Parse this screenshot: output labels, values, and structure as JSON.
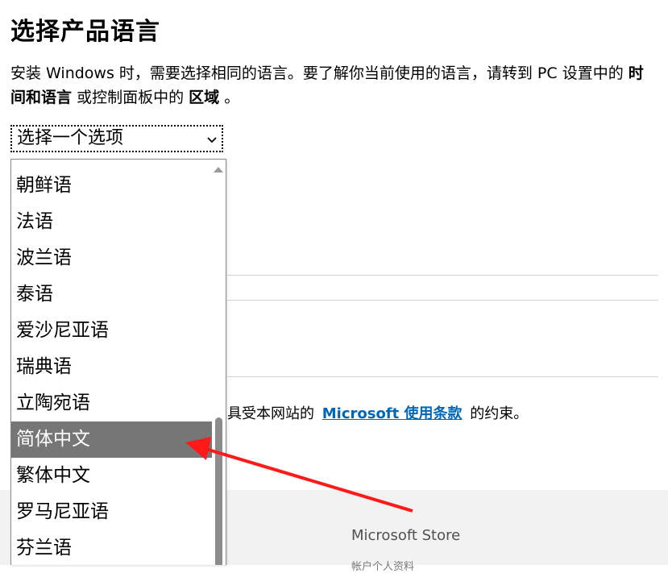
{
  "page": {
    "title": "选择产品语言",
    "description": {
      "part1": "安装 Windows 时，需要选择相同的语言。要了解你当前使用的语言，请转到 PC 设置中的",
      "bold1": "时间和语言",
      "part2": "或控制面板中的",
      "bold2": "区域",
      "part3": "。"
    }
  },
  "select": {
    "selected_label": "选择一个选项",
    "chevron_icon": "chevron-down-icon",
    "options": [
      "朝鲜语",
      "法语",
      "波兰语",
      "泰语",
      "爱沙尼亚语",
      "瑞典语",
      "立陶宛语",
      "简体中文",
      "繁体中文",
      "罗马尼亚语",
      "芬兰语"
    ],
    "highlighted_option": "简体中文"
  },
  "terms": {
    "prefix": "具受本网站的",
    "link": "Microsoft 使用条款",
    "suffix": "的约束。"
  },
  "footer": {
    "heading": "Microsoft Store",
    "subtext": "帐户个人资料"
  },
  "annotation": {
    "arrow_color": "#ff0000"
  }
}
